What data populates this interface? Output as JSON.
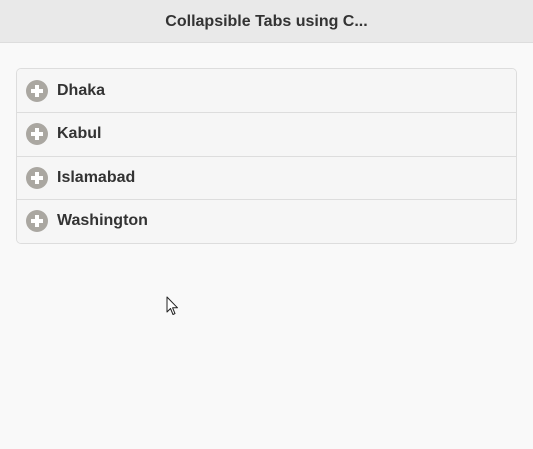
{
  "header": {
    "title": "Collapsible Tabs using C..."
  },
  "collapsible": {
    "items": [
      {
        "label": "Dhaka",
        "icon": "plus-icon"
      },
      {
        "label": "Kabul",
        "icon": "plus-icon"
      },
      {
        "label": "Islamabad",
        "icon": "plus-icon"
      },
      {
        "label": "Washington",
        "icon": "plus-icon"
      }
    ]
  },
  "colors": {
    "header_bg": "#e9e9e9",
    "page_bg": "#f9f9f9",
    "item_bg": "#f6f6f6",
    "icon": "#aaa7a1",
    "text": "#333333"
  }
}
